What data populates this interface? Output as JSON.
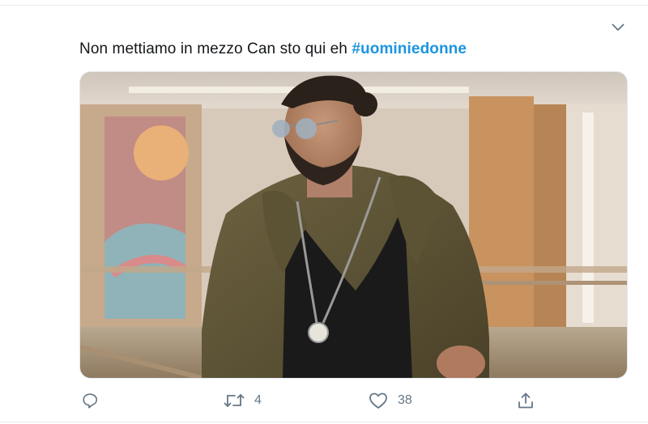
{
  "tweet": {
    "text": "Non mettiamo in mezzo Can sto qui eh ",
    "hashtag": "#uominiedonne",
    "menu_icon": "chevron-down-icon"
  },
  "media": {
    "type": "photo"
  },
  "actions": {
    "reply": {
      "icon": "reply-icon"
    },
    "retweet": {
      "icon": "retweet-icon",
      "count": "4"
    },
    "like": {
      "icon": "heart-icon",
      "count": "38"
    },
    "share": {
      "icon": "share-icon"
    }
  },
  "colors": {
    "text": "#14171a",
    "hashtag": "#1b95e0",
    "icon": "#657786"
  }
}
